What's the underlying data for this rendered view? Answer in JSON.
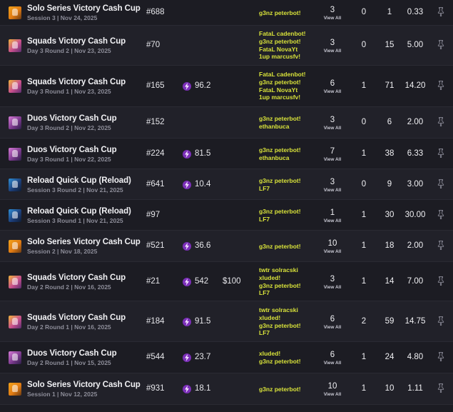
{
  "rows": [
    {
      "mode": "solo",
      "name": "Solo Series Victory Cash Cup",
      "sub": "Session 3 | Nov 24, 2025",
      "rank": "#688",
      "points": "",
      "earnings": "",
      "team": [
        "g3nz peterbot!"
      ],
      "matches": "3",
      "view_all": "View All",
      "wins": "0",
      "elims": "1",
      "kd": "0.33"
    },
    {
      "mode": "squads",
      "name": "Squads Victory Cash Cup",
      "sub": "Day 3 Round 2 | Nov 23, 2025",
      "rank": "#70",
      "points": "",
      "earnings": "",
      "team": [
        "FataL cadenbot!",
        "g3nz peterbot!",
        "FataL NovaYt",
        "1up marcusfv!"
      ],
      "matches": "3",
      "view_all": "View All",
      "wins": "0",
      "elims": "15",
      "kd": "5.00"
    },
    {
      "mode": "squads",
      "name": "Squads Victory Cash Cup",
      "sub": "Day 3 Round 1 | Nov 23, 2025",
      "rank": "#165",
      "points": "96.2",
      "earnings": "",
      "team": [
        "FataL cadenbot!",
        "g3nz peterbot!",
        "FataL NovaYt",
        "1up marcusfv!"
      ],
      "matches": "6",
      "view_all": "View All",
      "wins": "1",
      "elims": "71",
      "kd": "14.20"
    },
    {
      "mode": "duos",
      "name": "Duos Victory Cash Cup",
      "sub": "Day 3 Round 2 | Nov 22, 2025",
      "rank": "#152",
      "points": "",
      "earnings": "",
      "team": [
        "g3nz peterbot!",
        "ethanbuca"
      ],
      "matches": "3",
      "view_all": "View All",
      "wins": "0",
      "elims": "6",
      "kd": "2.00"
    },
    {
      "mode": "duos",
      "name": "Duos Victory Cash Cup",
      "sub": "Day 3 Round 1 | Nov 22, 2025",
      "rank": "#224",
      "points": "81.5",
      "earnings": "",
      "team": [
        "g3nz peterbot!",
        "ethanbuca"
      ],
      "matches": "7",
      "view_all": "View All",
      "wins": "1",
      "elims": "38",
      "kd": "6.33"
    },
    {
      "mode": "reload",
      "name": "Reload Quick Cup (Reload)",
      "sub": "Session 3 Round 2 | Nov 21, 2025",
      "rank": "#641",
      "points": "10.4",
      "earnings": "",
      "team": [
        "g3nz peterbot!",
        "LF7"
      ],
      "matches": "3",
      "view_all": "View All",
      "wins": "0",
      "elims": "9",
      "kd": "3.00"
    },
    {
      "mode": "reload",
      "name": "Reload Quick Cup (Reload)",
      "sub": "Session 3 Round 1 | Nov 21, 2025",
      "rank": "#97",
      "points": "",
      "earnings": "",
      "team": [
        "g3nz peterbot!",
        "LF7"
      ],
      "matches": "1",
      "view_all": "View All",
      "wins": "1",
      "elims": "30",
      "kd": "30.00"
    },
    {
      "mode": "solo",
      "name": "Solo Series Victory Cash Cup",
      "sub": "Session 2 | Nov 18, 2025",
      "rank": "#521",
      "points": "36.6",
      "earnings": "",
      "team": [
        "g3nz peterbot!"
      ],
      "matches": "10",
      "view_all": "View All",
      "wins": "1",
      "elims": "18",
      "kd": "2.00"
    },
    {
      "mode": "squads",
      "name": "Squads Victory Cash Cup",
      "sub": "Day 2 Round 2 | Nov 16, 2025",
      "rank": "#21",
      "points": "542",
      "earnings": "$100",
      "team": [
        "twtr solracski",
        "xluded!",
        "g3nz peterbot!",
        "LF7"
      ],
      "matches": "3",
      "view_all": "View All",
      "wins": "1",
      "elims": "14",
      "kd": "7.00"
    },
    {
      "mode": "squads",
      "name": "Squads Victory Cash Cup",
      "sub": "Day 2 Round 1 | Nov 16, 2025",
      "rank": "#184",
      "points": "91.5",
      "earnings": "",
      "team": [
        "twtr solracski",
        "xluded!",
        "g3nz peterbot!",
        "LF7"
      ],
      "matches": "6",
      "view_all": "View All",
      "wins": "2",
      "elims": "59",
      "kd": "14.75"
    },
    {
      "mode": "duos",
      "name": "Duos Victory Cash Cup",
      "sub": "Day 2 Round 1 | Nov 15, 2025",
      "rank": "#544",
      "points": "23.7",
      "earnings": "",
      "team": [
        "xluded!",
        "g3nz peterbot!"
      ],
      "matches": "6",
      "view_all": "View All",
      "wins": "1",
      "elims": "24",
      "kd": "4.80"
    },
    {
      "mode": "solo",
      "name": "Solo Series Victory Cash Cup",
      "sub": "Session 1 | Nov 12, 2025",
      "rank": "#931",
      "points": "18.1",
      "earnings": "",
      "team": [
        "g3nz peterbot!"
      ],
      "matches": "10",
      "view_all": "View All",
      "wins": "1",
      "elims": "10",
      "kd": "1.11"
    }
  ]
}
